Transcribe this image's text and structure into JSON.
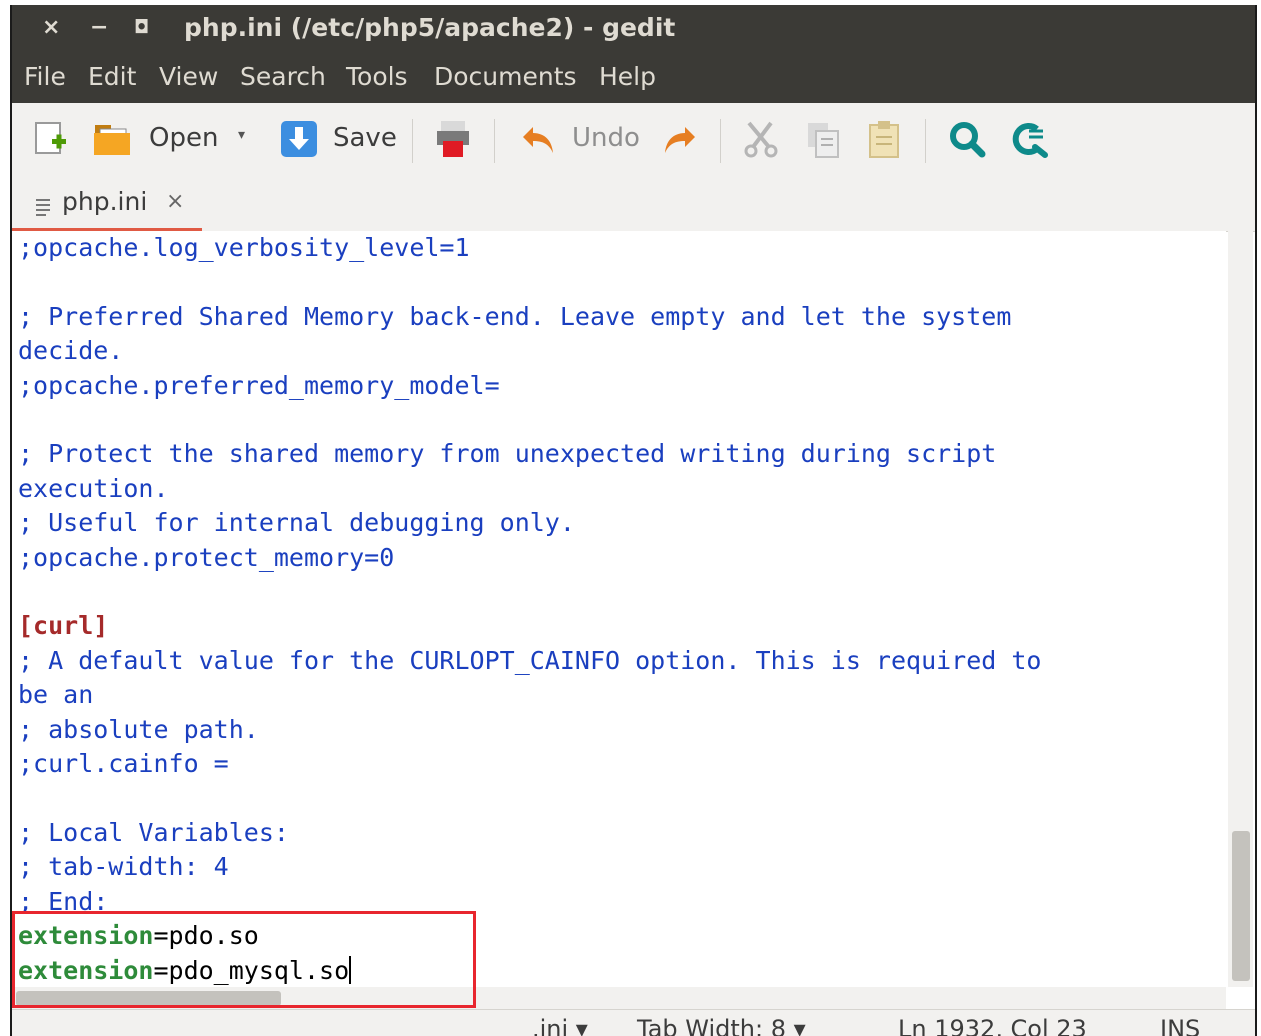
{
  "window": {
    "title": "php.ini (/etc/php5/apache2) - gedit",
    "controls": {
      "close": "×",
      "minimize": "−",
      "maximize": "◘"
    }
  },
  "menubar": {
    "items": [
      "File",
      "Edit",
      "View",
      "Search",
      "Tools",
      "Documents",
      "Help"
    ]
  },
  "toolbar": {
    "open_label": "Open",
    "save_label": "Save",
    "undo_label": "Undo",
    "dropdown_arrow": "▾"
  },
  "tabs": [
    {
      "label": "php.ini",
      "close": "×"
    }
  ],
  "editor": {
    "lines": [
      {
        "type": "comment",
        "text": ";opcache.log_verbosity_level=1"
      },
      {
        "type": "blank",
        "text": ""
      },
      {
        "type": "comment",
        "text": "; Preferred Shared Memory back-end. Leave empty and let the system"
      },
      {
        "type": "comment",
        "text": "decide."
      },
      {
        "type": "comment",
        "text": ";opcache.preferred_memory_model="
      },
      {
        "type": "blank",
        "text": ""
      },
      {
        "type": "comment",
        "text": "; Protect the shared memory from unexpected writing during script"
      },
      {
        "type": "comment",
        "text": "execution."
      },
      {
        "type": "comment",
        "text": "; Useful for internal debugging only."
      },
      {
        "type": "comment",
        "text": ";opcache.protect_memory=0"
      },
      {
        "type": "blank",
        "text": ""
      },
      {
        "type": "section",
        "text": "[curl]"
      },
      {
        "type": "comment",
        "text": "; A default value for the CURLOPT_CAINFO option. This is required to"
      },
      {
        "type": "comment",
        "text": "be an"
      },
      {
        "type": "comment",
        "text": "; absolute path."
      },
      {
        "type": "comment",
        "text": ";curl.cainfo ="
      },
      {
        "type": "blank",
        "text": ""
      },
      {
        "type": "comment",
        "text": "; Local Variables:"
      },
      {
        "type": "comment",
        "text": "; tab-width: 4"
      },
      {
        "type": "comment",
        "text": "; End:"
      },
      {
        "type": "keyvalue",
        "key": "extension",
        "value": "=pdo.so"
      },
      {
        "type": "keyvalue",
        "key": "extension",
        "value": "=pdo_mysql.so",
        "cursor": true
      }
    ]
  },
  "statusbar": {
    "language": ".ini ▾",
    "tab_width": "Tab Width: 8 ▾",
    "position": "Ln 1932, Col 23",
    "mode": "INS"
  },
  "colors": {
    "comment": "#1a3fbf",
    "section": "#a52a2a",
    "key": "#2e8b3a",
    "annotation_box": "#e8262e",
    "titlebar": "#3b3a36"
  }
}
